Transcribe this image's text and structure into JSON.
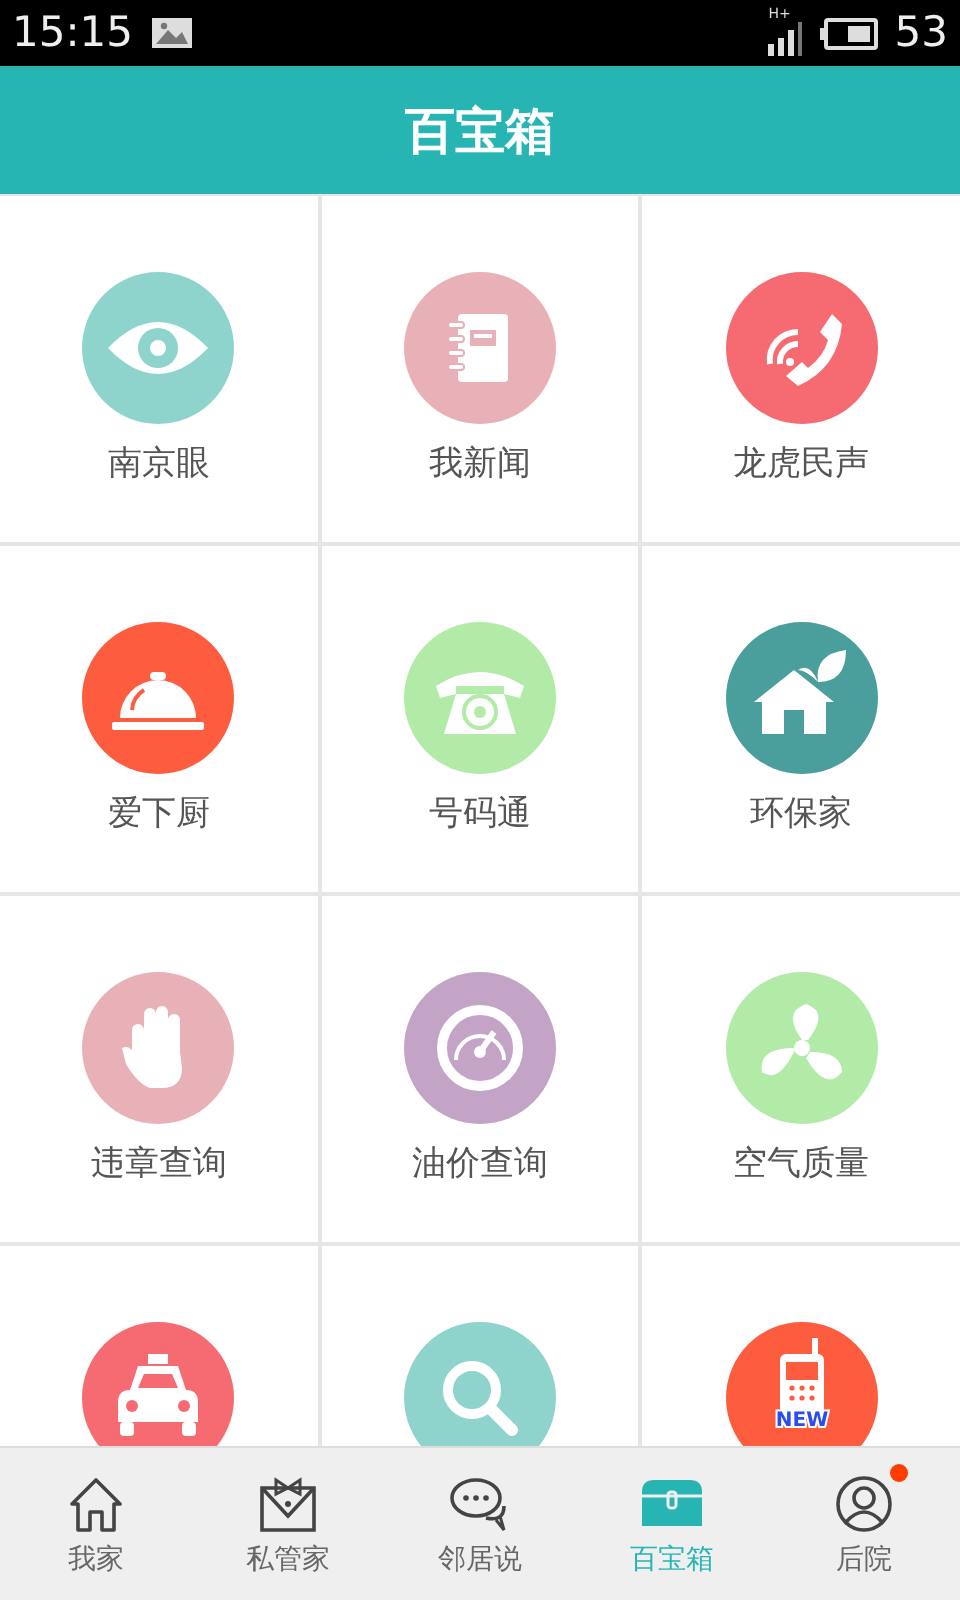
{
  "status_bar": {
    "time": "15:15",
    "signal_label": "H+",
    "battery": "53"
  },
  "header": {
    "title": "百宝箱"
  },
  "tiles": [
    {
      "color": "#8fd4cc",
      "label": "南京眼"
    },
    {
      "color": "#e8b1b7",
      "label": "我新闻"
    },
    {
      "color": "#f66a72",
      "label": "龙虎民声"
    },
    {
      "color": "#fd5c3e",
      "label": "爱下厨"
    },
    {
      "color": "#b2eaa7",
      "label": "号码通"
    },
    {
      "color": "#4a9e9c",
      "label": "环保家"
    },
    {
      "color": "#e8b1b7",
      "label": "违章查询"
    },
    {
      "color": "#c3a3c6",
      "label": "油价查询"
    },
    {
      "color": "#b2eaa7",
      "label": "空气质量"
    },
    {
      "color": "#f66a72"
    },
    {
      "color": "#8fd4cc"
    },
    {
      "color": "#fd5c3e",
      "badge": "NEW"
    }
  ],
  "tab_bar": [
    {
      "label": "我家",
      "selected": false,
      "dot": false
    },
    {
      "label": "私管家",
      "selected": false,
      "dot": false
    },
    {
      "label": "邻居说",
      "selected": false,
      "dot": false
    },
    {
      "label": "百宝箱",
      "selected": true,
      "dot": false
    },
    {
      "label": "后院",
      "selected": false,
      "dot": true
    }
  ]
}
